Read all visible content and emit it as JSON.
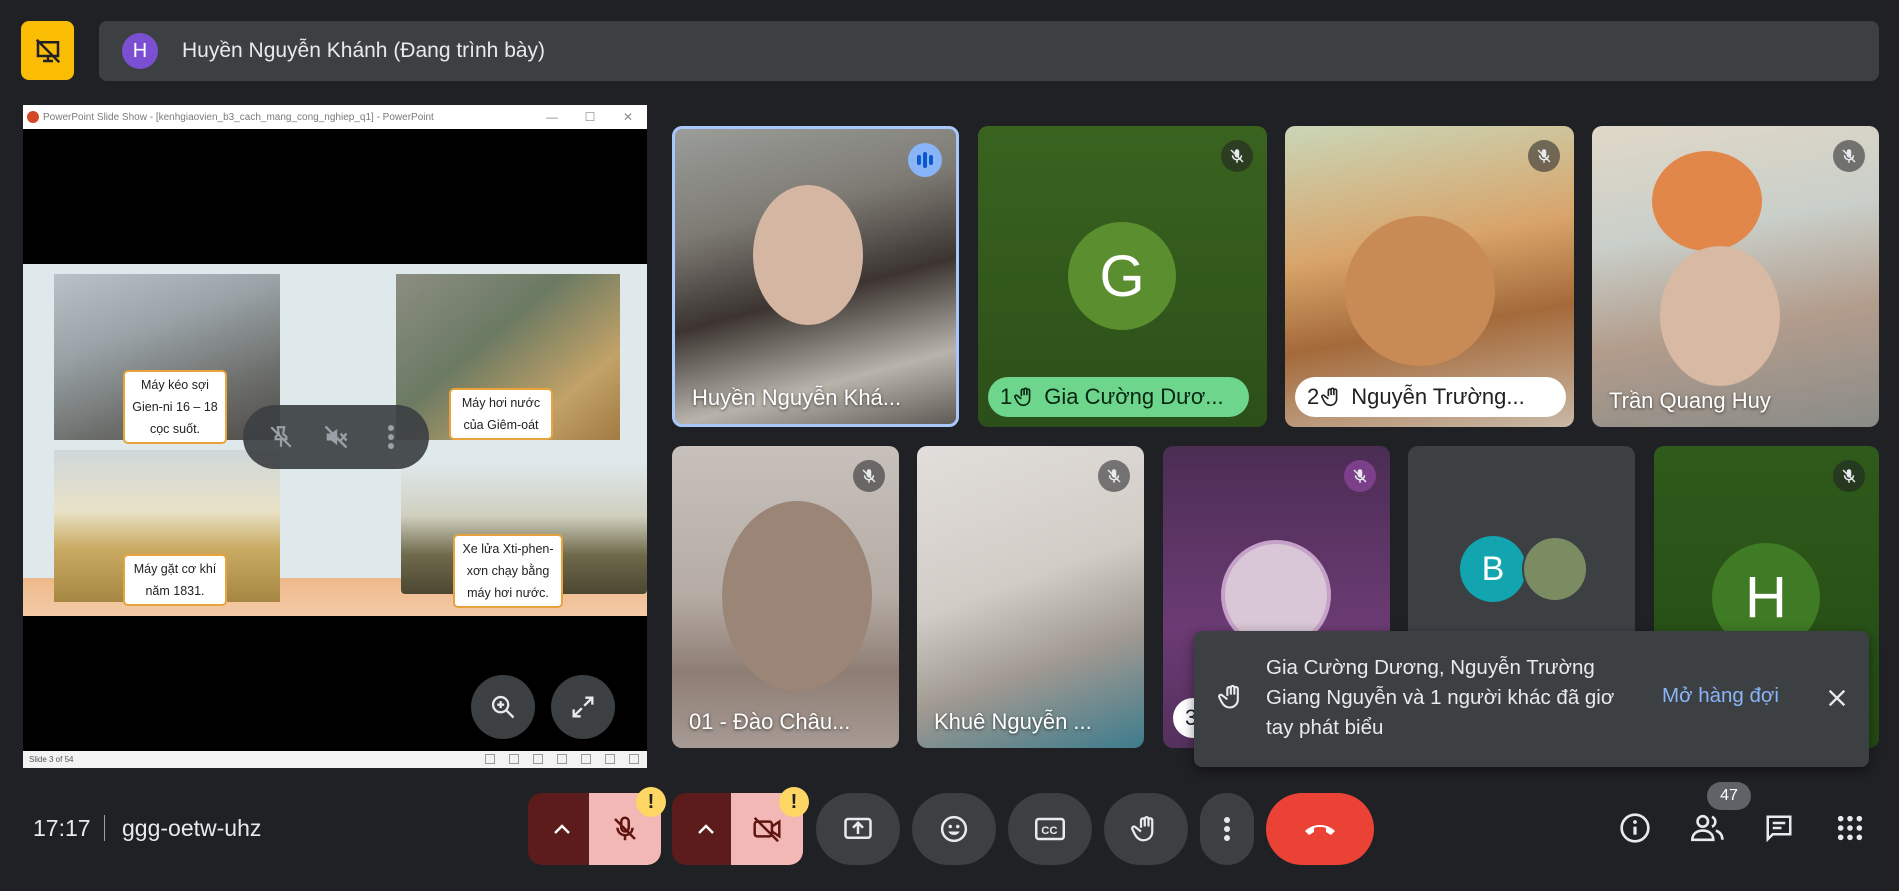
{
  "presenter": {
    "avatar_letter": "H",
    "label": "Huyền Nguyễn Khánh (Đang trình bày)"
  },
  "presentation": {
    "window_title": "PowerPoint Slide Show - [kenhgiaovien_b3_cach_mang_cong_nghiep_q1] - PowerPoint",
    "window_buttons": [
      "—",
      "☐",
      "✕"
    ],
    "status_text": "Slide 3 of 54",
    "callouts": {
      "spinning": "Máy kéo sợi Gien-ni 16 – 18 cọc suốt.",
      "steam": "Máy hơi nước của Giêm-oát",
      "harvester": "Máy gặt cơ khí năm 1831.",
      "train": "Xe lửa Xti-phen-xơn chạy bằng máy hơi nước."
    }
  },
  "tiles": [
    {
      "id": "huyen",
      "name": "Huyền Nguyễn Khá...",
      "status": "speaking"
    },
    {
      "id": "gia",
      "name": "Gia Cường Dươ...",
      "avatar_letter": "G",
      "hand_number": "1",
      "status": "muted",
      "avatar_color": "#5b8e2f"
    },
    {
      "id": "nguyen",
      "name": "Nguyễn Trường...",
      "hand_number": "2",
      "status": "muted"
    },
    {
      "id": "tran",
      "name": "Trần Quang Huy",
      "status": "muted"
    },
    {
      "id": "dao",
      "name": "01 - Đào Châu...",
      "status": "muted"
    },
    {
      "id": "khue",
      "name": "Khuê Nguyễn ...",
      "status": "muted"
    },
    {
      "id": "anime",
      "name": "",
      "hand_number": "3",
      "status": "muted"
    },
    {
      "id": "group",
      "avatar_letter": "B",
      "avatar_color": "#12a4af"
    },
    {
      "id": "h",
      "avatar_letter": "H",
      "status": "muted",
      "avatar_color": "#3f7a24"
    }
  ],
  "toast": {
    "message": "Gia Cường Dương, Nguyễn Trường Giang Nguyễn và 1 người khác đã giơ tay phát biểu",
    "action": "Mở hàng đợi"
  },
  "bottom_bar": {
    "time": "17:17",
    "meeting_code": "ggg-oetw-uhz",
    "people_count": "47",
    "warning_glyph": "!"
  },
  "colors": {
    "background": "#202124",
    "accent": "#8ab4f8",
    "hangup": "#ea4335",
    "hand_green": "#6dd58c",
    "warning": "#fdd663",
    "presenter_icon": "#fbbc04"
  }
}
